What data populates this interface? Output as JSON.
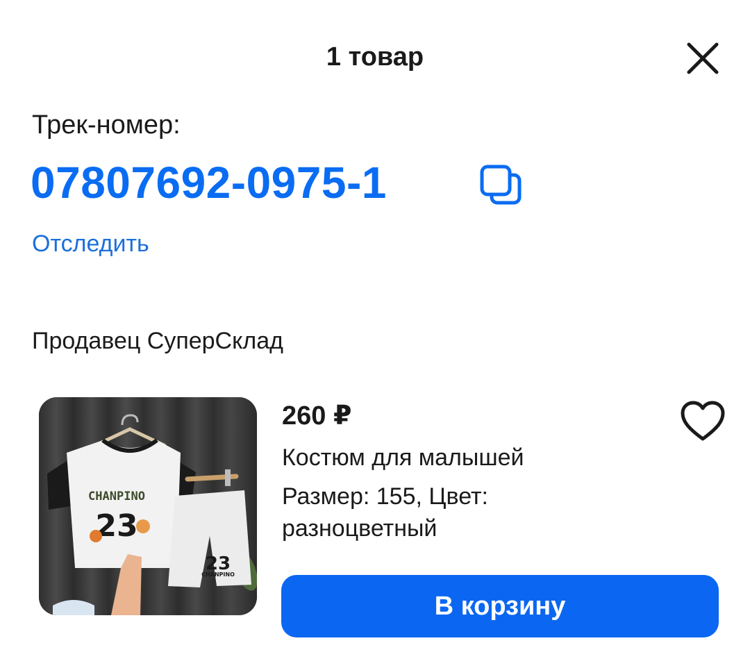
{
  "header": {
    "title": "1 товар",
    "close_icon": "close-icon"
  },
  "tracking": {
    "label": "Трек-номер:",
    "number": "07807692-0975-1",
    "copy_icon": "copy-icon",
    "track_link": "Отследить"
  },
  "seller": {
    "text": "Продавец СуперСклад"
  },
  "product": {
    "price": "260 ₽",
    "name": "Костюм для малышей",
    "attributes": "Размер: 155, Цвет: разноцветный",
    "favorite_icon": "heart-icon",
    "image": {
      "shirt_text": "CHANPINO",
      "shirt_number": "23",
      "shorts_number": "23",
      "shorts_text": "CHANPINO"
    },
    "add_to_cart_label": "В корзину"
  },
  "colors": {
    "accent": "#0b67f2",
    "link": "#1c6fdc",
    "text": "#1a1a1a",
    "background": "#ffffff"
  }
}
